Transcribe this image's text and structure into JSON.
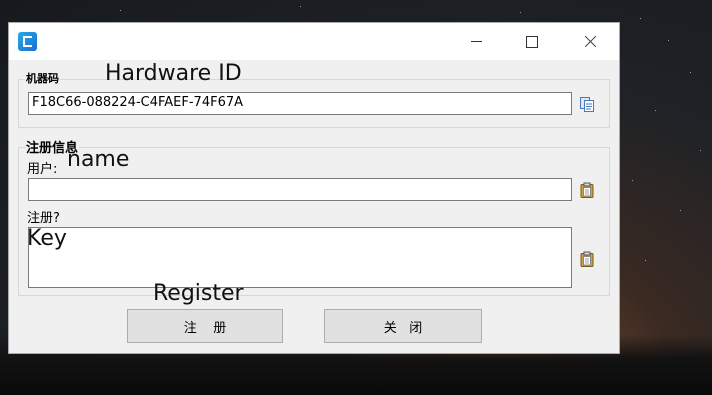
{
  "window": {
    "title": ""
  },
  "hardware": {
    "label": "机器码",
    "annotation": "Hardware ID",
    "value": "F18C66-088224-C4FAEF-74F67A"
  },
  "registration": {
    "group_label": "注册信息",
    "user_label": "用户:",
    "user_annotation": "name",
    "user_value": "",
    "key_label": "注册?",
    "key_annotation": "Key",
    "key_value": ""
  },
  "buttons": {
    "register_label": "注    册",
    "register_annotation": "Register",
    "close_label": "关   闭"
  },
  "icons": {
    "app": "app-logo-icon",
    "copy": "copy-icon",
    "paste": "paste-icon"
  }
}
